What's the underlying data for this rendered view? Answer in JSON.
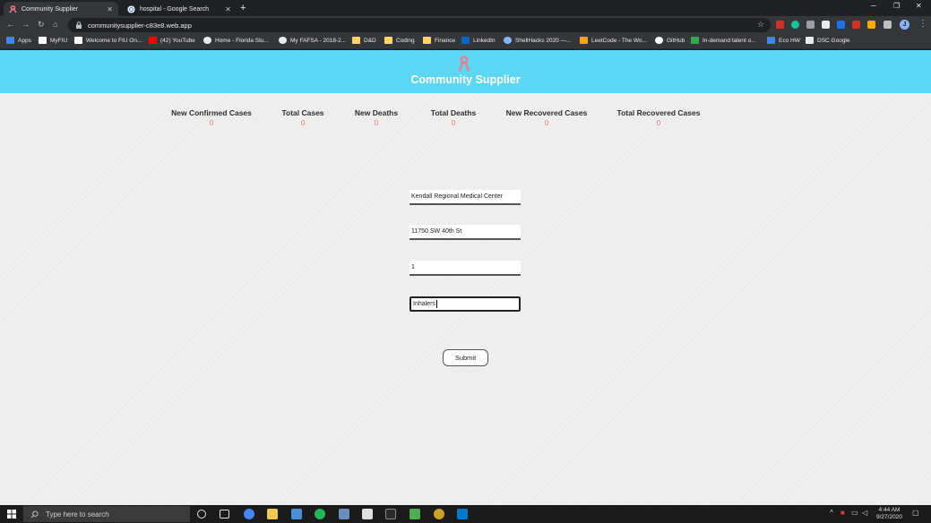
{
  "browser": {
    "tabs": [
      {
        "title": "Community Supplier",
        "active": true
      },
      {
        "title": "hospital - Google Search",
        "active": false
      }
    ],
    "url": "communitysupplier-c83e8.web.app",
    "bookmarks": [
      {
        "label": "Apps"
      },
      {
        "label": "MyFIU"
      },
      {
        "label": "Welcome to FIU On..."
      },
      {
        "label": "(42) YouTube"
      },
      {
        "label": "Home - Florida Stu..."
      },
      {
        "label": "My FAFSA - 2018-2..."
      },
      {
        "label": "D&D"
      },
      {
        "label": "Coding"
      },
      {
        "label": "Finance"
      },
      {
        "label": "LinkedIn"
      },
      {
        "label": "ShellHacks 2020 —..."
      },
      {
        "label": "LeetCode - The Wo..."
      },
      {
        "label": "GitHub"
      },
      {
        "label": "In-demand talent o..."
      },
      {
        "label": "Eco HW"
      },
      {
        "label": "DSC Google"
      }
    ],
    "profile_initial": "J"
  },
  "site": {
    "title": "Community Supplier",
    "accent_color": "#5dd6f4",
    "ribbon_color": "#f47b8e"
  },
  "stats": [
    {
      "label": "New Confirmed Cases",
      "value": "0"
    },
    {
      "label": "Total Cases",
      "value": "0"
    },
    {
      "label": "New Deaths",
      "value": "0"
    },
    {
      "label": "Total Deaths",
      "value": "0"
    },
    {
      "label": "New Recovered Cases",
      "value": "0"
    },
    {
      "label": "Total Recovered Cases",
      "value": "0"
    }
  ],
  "form": {
    "hospital_name": "Kendall Regional Medical Center",
    "address": "11750 SW 40th St",
    "quantity": "1",
    "item": "Inhalers",
    "submit_label": "Submit"
  },
  "taskbar": {
    "search_placeholder": "Type here to search",
    "time": "4:44 AM",
    "date": "9/27/2020"
  }
}
